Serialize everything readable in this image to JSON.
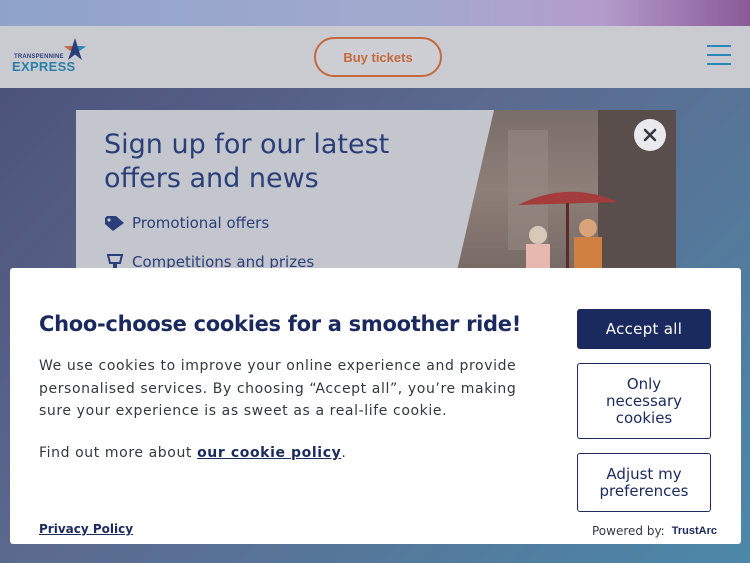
{
  "header": {
    "logo_top": "TRANSPENNINE",
    "logo_bottom": "EXPRESS",
    "buy_tickets_label": "Buy tickets",
    "menu_icon": "hamburger-menu-icon"
  },
  "signup": {
    "title": "Sign up for our latest offers and news",
    "items": [
      {
        "icon": "tag-icon",
        "label": "Promotional offers"
      },
      {
        "icon": "trophy-icon",
        "label": "Competitions and prizes"
      }
    ],
    "close_icon": "close-icon"
  },
  "cookie": {
    "title": "Choo-choose cookies for a smoother ride!",
    "body": "We use cookies to improve your online experience and provide personalised services. By choosing “Accept all”, you’re making sure your experience is as sweet as a real-life cookie.",
    "more_prefix": "Find out more about ",
    "more_link": "our cookie policy",
    "more_suffix": ".",
    "accept_all": "Accept all",
    "only_necessary": "Only necessary cookies",
    "adjust": "Adjust my preferences",
    "privacy_policy": "Privacy Policy",
    "powered_by": "Powered by:",
    "trustarc": "TrustArc"
  },
  "colors": {
    "brand_navy": "#1a2a5e",
    "brand_blue": "#2a89b8",
    "accent_orange": "#c4693b"
  }
}
